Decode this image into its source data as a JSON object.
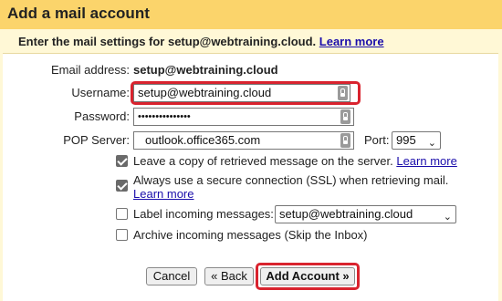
{
  "dialog": {
    "title": "Add a mail account",
    "intro_text": "Enter the mail settings for setup@webtraining.cloud.",
    "intro_link": "Learn more"
  },
  "form": {
    "email_label": "Email address:",
    "email_value": "setup@webtraining.cloud",
    "username_label": "Username:",
    "username_value": "setup@webtraining.cloud",
    "password_label": "Password:",
    "password_value": "•••••••••••••••",
    "pop_label": "POP Server:",
    "pop_value": "outlook.office365.com",
    "port_label": "Port:",
    "port_value": "995"
  },
  "options": {
    "leave_copy": {
      "label": "Leave a copy of retrieved message on the server.",
      "link": "Learn more",
      "checked": true
    },
    "ssl": {
      "label": "Always use a secure connection (SSL) when retrieving mail.",
      "link": "Learn more",
      "checked": true
    },
    "label_incoming": {
      "label": "Label incoming messages:",
      "select_value": "setup@webtraining.cloud",
      "checked": false
    },
    "archive": {
      "label": "Archive incoming messages (Skip the Inbox)",
      "checked": false
    }
  },
  "buttons": {
    "cancel": "Cancel",
    "back": "« Back",
    "add": "Add Account »"
  },
  "colors": {
    "title_bar": "#fbd46b",
    "background": "#fff8d6",
    "highlight": "#d9232e",
    "link": "#1a0dab"
  }
}
